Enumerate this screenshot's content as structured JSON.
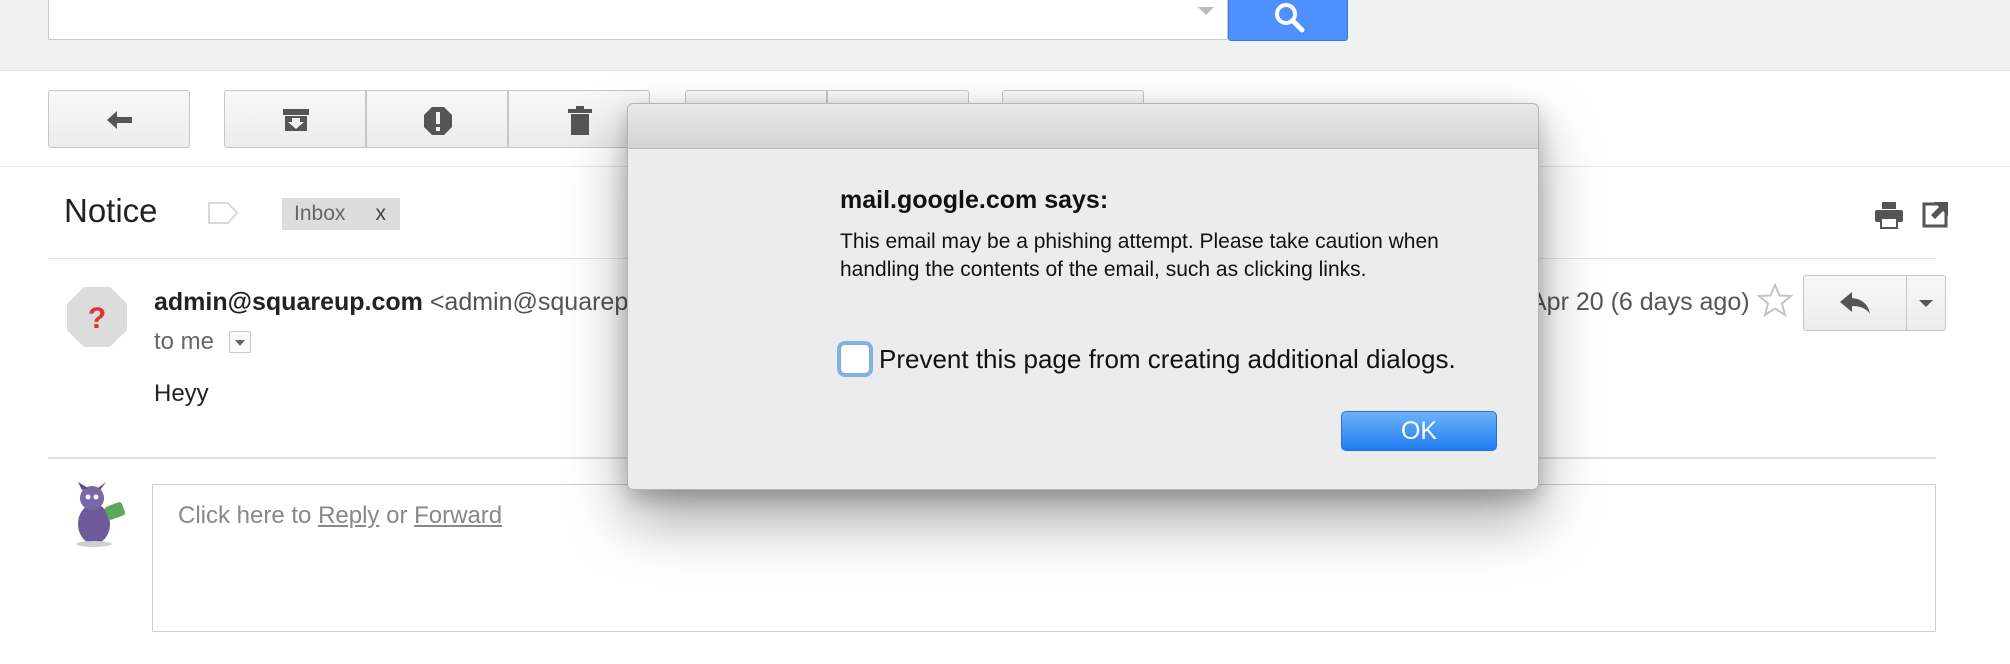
{
  "search": {
    "placeholder": ""
  },
  "toolbar": {
    "back_icon": "back-arrow-icon",
    "archive_icon": "archive-icon",
    "spam_icon": "report-spam-icon",
    "delete_icon": "trash-icon"
  },
  "email": {
    "subject": "Notice",
    "label": "Inbox",
    "label_remove": "x",
    "sender_name": "admin@squareup.com",
    "sender_address": "<admin@squarep",
    "recipient": "to me",
    "date": "Apr 20 (6 days ago)",
    "body": "Heyy"
  },
  "reply": {
    "prefix": "Click here to ",
    "reply_link": "Reply",
    "middle": " or ",
    "forward_link": "Forward"
  },
  "dialog": {
    "title": "mail.google.com says:",
    "message": "This email may be a phishing attempt. Please take caution when handling the contents of the email, such as clicking links.",
    "checkbox_label": "Prevent this page from creating additional dialogs.",
    "checkbox_checked": false,
    "ok_label": "OK"
  },
  "colors": {
    "accent": "#4d90fe",
    "dialog_button": "#1f7cf0"
  }
}
